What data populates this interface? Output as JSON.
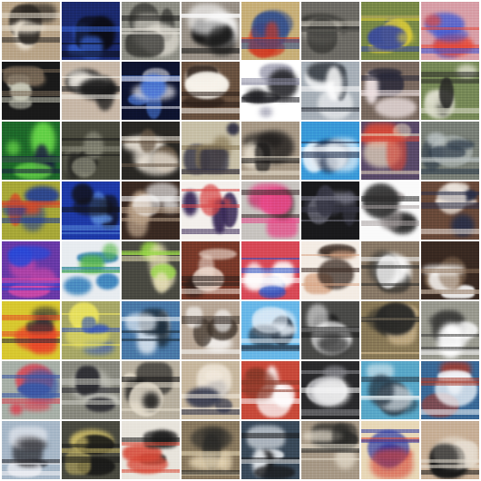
{
  "grid": {
    "rows": 8,
    "cols": 8,
    "tiles": [
      {
        "bg": "#b9a58a",
        "accent": "#2a2622",
        "hi": "#e9e0d0"
      },
      {
        "bg": "#1b2a6e",
        "accent": "#3a66d8",
        "hi": "#0c0c14"
      },
      {
        "bg": "#8f8f86",
        "accent": "#1e1e1c",
        "hi": "#e8e4da"
      },
      {
        "bg": "#9a9288",
        "accent": "#141414",
        "hi": "#fafafa"
      },
      {
        "bg": "#c8b07a",
        "accent": "#d23a22",
        "hi": "#2a4a90"
      },
      {
        "bg": "#6e6c66",
        "accent": "#2a2a28",
        "hi": "#b8b4aa"
      },
      {
        "bg": "#7a8a48",
        "accent": "#e4d238",
        "hi": "#3a4aa0"
      },
      {
        "bg": "#d8a0a8",
        "accent": "#3a5ad8",
        "hi": "#e84a38"
      },
      {
        "bg": "#1a1a1a",
        "accent": "#c8c8b8",
        "hi": "#7a6a58"
      },
      {
        "bg": "#c8b8a8",
        "accent": "#1a1a1a",
        "hi": "#f4f0e8"
      },
      {
        "bg": "#0e1430",
        "accent": "#4a78d8",
        "hi": "#e8e8f0"
      },
      {
        "bg": "#6a5240",
        "accent": "#f8f4ec",
        "hi": "#2a1e18"
      },
      {
        "bg": "#ffffff",
        "accent": "#1e1e22",
        "hi": "#8a8aa0"
      },
      {
        "bg": "#a8b0b8",
        "accent": "#ffffff",
        "hi": "#3a4048"
      },
      {
        "bg": "#7a6a60",
        "accent": "#2a2a3a",
        "hi": "#f0e4e4"
      },
      {
        "bg": "#788a58",
        "accent": "#e0e0d0",
        "hi": "#2a2a28"
      },
      {
        "bg": "#1e6a2a",
        "accent": "#6ad84a",
        "hi": "#1a1a40"
      },
      {
        "bg": "#4a4a3e",
        "accent": "#8a8a7a",
        "hi": "#1a1a18"
      },
      {
        "bg": "#2a2824",
        "accent": "#f4ece0",
        "hi": "#6a5a48"
      },
      {
        "bg": "#c8c0a8",
        "accent": "#2a2a40",
        "hi": "#8a7a58"
      },
      {
        "bg": "#a89a88",
        "accent": "#1a1818",
        "hi": "#e8e0d0"
      },
      {
        "bg": "#3a9ad8",
        "accent": "#f4f8fc",
        "hi": "#1a2a48"
      },
      {
        "bg": "#5a4a6a",
        "accent": "#d84a3a",
        "hi": "#e8d8c0"
      },
      {
        "bg": "#7a8078",
        "accent": "#2a3848",
        "hi": "#b8c0c0"
      },
      {
        "bg": "#a8a838",
        "accent": "#1e3a9a",
        "hi": "#d84a28"
      },
      {
        "bg": "#1e3aa8",
        "accent": "#121218",
        "hi": "#5a8ad8"
      },
      {
        "bg": "#3a2a22",
        "accent": "#ffffff",
        "hi": "#b8a088"
      },
      {
        "bg": "#f4f0ec",
        "accent": "#3a2a58",
        "hi": "#d84a4a"
      },
      {
        "bg": "#c8c4c0",
        "accent": "#e84a8a",
        "hi": "#3a2a2a"
      },
      {
        "bg": "#1a1a1c",
        "accent": "#3a3a48",
        "hi": "#7a7a88"
      },
      {
        "bg": "#fafafa",
        "accent": "#2a2a2a",
        "hi": "#a8a0a0"
      },
      {
        "bg": "#6a4a3a",
        "accent": "#f0e8e0",
        "hi": "#2a3048"
      },
      {
        "bg": "#6a3aa8",
        "accent": "#d84aa8",
        "hi": "#2a4ad8"
      },
      {
        "bg": "#e8ecf0",
        "accent": "#2a7ab8",
        "hi": "#5ab84a"
      },
      {
        "bg": "#4a4a42",
        "accent": "#e8e0b8",
        "hi": "#9ad848"
      },
      {
        "bg": "#7a3a2a",
        "accent": "#f4e4d8",
        "hi": "#2a1e1a"
      },
      {
        "bg": "#d84a58",
        "accent": "#ffffff",
        "hi": "#2a58c8"
      },
      {
        "bg": "#f4ece4",
        "accent": "#3a2a22",
        "hi": "#d8a888"
      },
      {
        "bg": "#8a7a68",
        "accent": "#fafafa",
        "hi": "#2a2a28"
      },
      {
        "bg": "#3a2a22",
        "accent": "#ffffff",
        "hi": "#8a7058"
      },
      {
        "bg": "#d8c830",
        "accent": "#2a2a38",
        "hi": "#e84a2a"
      },
      {
        "bg": "#a8a868",
        "accent": "#3a5ab8",
        "hi": "#f0e860"
      },
      {
        "bg": "#4a7aa8",
        "accent": "#f4f8fc",
        "hi": "#1a2a38"
      },
      {
        "bg": "#b8a898",
        "accent": "#ffffff",
        "hi": "#3a3028"
      },
      {
        "bg": "#6ab8e8",
        "accent": "#e8f0f8",
        "hi": "#2a3848"
      },
      {
        "bg": "#4a4a48",
        "accent": "#f8f8f8",
        "hi": "#1a1a1a"
      },
      {
        "bg": "#8a7a58",
        "accent": "#2a2a28",
        "hi": "#e0c8a0"
      },
      {
        "bg": "#9a9a90",
        "accent": "#ffffff",
        "hi": "#3a3a38"
      },
      {
        "bg": "#a8b0a8",
        "accent": "#d84a58",
        "hi": "#3a5aa8"
      },
      {
        "bg": "#8a8a80",
        "accent": "#2a2a30",
        "hi": "#c8c8c0"
      },
      {
        "bg": "#b8b0a0",
        "accent": "#1a1a1a",
        "hi": "#e8e0d0"
      },
      {
        "bg": "#c8b8a0",
        "accent": "#2a3048",
        "hi": "#f4ece0"
      },
      {
        "bg": "#c84a3a",
        "accent": "#ffffff",
        "hi": "#8a3a2a"
      },
      {
        "bg": "#2a2a2c",
        "accent": "#f8f8f8",
        "hi": "#8a8a90"
      },
      {
        "bg": "#5aa8c8",
        "accent": "#2a3a48",
        "hi": "#e8f0f4"
      },
      {
        "bg": "#3a6a98",
        "accent": "#f4f8fc",
        "hi": "#a83a2a"
      },
      {
        "bg": "#a8b8c8",
        "accent": "#2a2a30",
        "hi": "#f4f4f8"
      },
      {
        "bg": "#4a4a40",
        "accent": "#c8b868",
        "hi": "#1a1a18"
      },
      {
        "bg": "#e8e4dc",
        "accent": "#1a1a1a",
        "hi": "#d84a38"
      },
      {
        "bg": "#8a7a60",
        "accent": "#2a2a28",
        "hi": "#e8d8b8"
      },
      {
        "bg": "#3a4a5a",
        "accent": "#e8ecf0",
        "hi": "#1a1a1c"
      },
      {
        "bg": "#a89a88",
        "accent": "#2a2a28",
        "hi": "#e8e0d0"
      },
      {
        "bg": "#e8d8b8",
        "accent": "#d84a3a",
        "hi": "#2a3aa8"
      },
      {
        "bg": "#c8b098",
        "accent": "#1a1a1a",
        "hi": "#e8e0d4"
      }
    ]
  }
}
